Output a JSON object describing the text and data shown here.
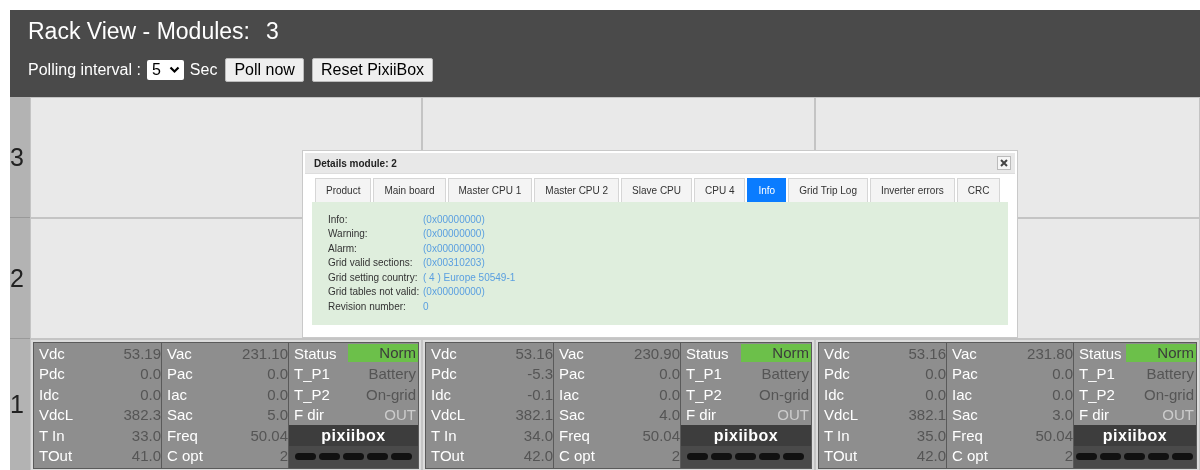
{
  "header": {
    "title": "Rack View - Modules:",
    "module_count": "3"
  },
  "controls": {
    "polling_label": "Polling interval :",
    "interval": "5",
    "unit": "Sec",
    "buttons": [
      "Poll now",
      "Reset PixiiBox"
    ]
  },
  "rack": {
    "rows": [
      {
        "number": "3",
        "modules": []
      },
      {
        "number": "2",
        "modules": []
      },
      {
        "number": "1",
        "modules": [
          {
            "left": [
              {
                "label": "Vdc",
                "value": "53.19"
              },
              {
                "label": "Pdc",
                "value": "0.0"
              },
              {
                "label": "Idc",
                "value": "0.0"
              },
              {
                "label": "VdcL",
                "value": "382.3"
              },
              {
                "label": "T In",
                "value": "33.0"
              },
              {
                "label": "TOut",
                "value": "41.0"
              }
            ],
            "middle": [
              {
                "label": "Vac",
                "value": "231.10"
              },
              {
                "label": "Pac",
                "value": "0.0"
              },
              {
                "label": "Iac",
                "value": "0.0"
              },
              {
                "label": "Sac",
                "value": "5.0"
              },
              {
                "label": "Freq",
                "value": "50.04"
              },
              {
                "label": "C opt",
                "value": "2"
              }
            ],
            "status": [
              {
                "label": "Status",
                "value": "Norm",
                "kind": "badge"
              },
              {
                "label": "T_P1",
                "value": "Battery",
                "kind": "plain"
              },
              {
                "label": "T_P2",
                "value": "On-grid",
                "kind": "plain"
              },
              {
                "label": "F dir",
                "value": "OUT",
                "kind": "dim"
              }
            ],
            "logo": "pixiibox"
          },
          {
            "left": [
              {
                "label": "Vdc",
                "value": "53.16"
              },
              {
                "label": "Pdc",
                "value": "-5.3"
              },
              {
                "label": "Idc",
                "value": "-0.1"
              },
              {
                "label": "VdcL",
                "value": "382.1"
              },
              {
                "label": "T In",
                "value": "34.0"
              },
              {
                "label": "TOut",
                "value": "42.0"
              }
            ],
            "middle": [
              {
                "label": "Vac",
                "value": "230.90"
              },
              {
                "label": "Pac",
                "value": "0.0"
              },
              {
                "label": "Iac",
                "value": "0.0"
              },
              {
                "label": "Sac",
                "value": "4.0"
              },
              {
                "label": "Freq",
                "value": "50.04"
              },
              {
                "label": "C opt",
                "value": "2"
              }
            ],
            "status": [
              {
                "label": "Status",
                "value": "Norm",
                "kind": "badge"
              },
              {
                "label": "T_P1",
                "value": "Battery",
                "kind": "plain"
              },
              {
                "label": "T_P2",
                "value": "On-grid",
                "kind": "plain"
              },
              {
                "label": "F dir",
                "value": "OUT",
                "kind": "dim"
              }
            ],
            "logo": "pixiibox"
          },
          {
            "left": [
              {
                "label": "Vdc",
                "value": "53.16"
              },
              {
                "label": "Pdc",
                "value": "0.0"
              },
              {
                "label": "Idc",
                "value": "0.0"
              },
              {
                "label": "VdcL",
                "value": "382.1"
              },
              {
                "label": "T In",
                "value": "35.0"
              },
              {
                "label": "TOut",
                "value": "42.0"
              }
            ],
            "middle": [
              {
                "label": "Vac",
                "value": "231.80"
              },
              {
                "label": "Pac",
                "value": "0.0"
              },
              {
                "label": "Iac",
                "value": "0.0"
              },
              {
                "label": "Sac",
                "value": "3.0"
              },
              {
                "label": "Freq",
                "value": "50.04"
              },
              {
                "label": "C opt",
                "value": "2"
              }
            ],
            "status": [
              {
                "label": "Status",
                "value": "Norm",
                "kind": "badge"
              },
              {
                "label": "T_P1",
                "value": "Battery",
                "kind": "plain"
              },
              {
                "label": "T_P2",
                "value": "On-grid",
                "kind": "plain"
              },
              {
                "label": "F dir",
                "value": "OUT",
                "kind": "dim"
              }
            ],
            "logo": "pixiibox"
          }
        ]
      }
    ]
  },
  "dialog": {
    "title": "Details module: 2",
    "tabs": [
      {
        "label": "Product",
        "selected": false
      },
      {
        "label": "Main board",
        "selected": false
      },
      {
        "label": "Master CPU 1",
        "selected": false
      },
      {
        "label": "Master CPU 2",
        "selected": false
      },
      {
        "label": "Slave CPU",
        "selected": false
      },
      {
        "label": "CPU 4",
        "selected": false
      },
      {
        "label": "Info",
        "selected": true
      },
      {
        "label": "Grid Trip Log",
        "selected": false
      },
      {
        "label": "Inverter errors",
        "selected": false
      },
      {
        "label": "CRC",
        "selected": false
      }
    ],
    "fields": [
      {
        "label": "Info:",
        "value": "(0x00000000)"
      },
      {
        "label": "Warning:",
        "value": "(0x00000000)"
      },
      {
        "label": "Alarm:",
        "value": "(0x00000000)"
      },
      {
        "label": "Grid valid sections:",
        "value": "(0x00310203)"
      },
      {
        "label": "Grid setting country:",
        "value": "( 4 ) Europe 50549-1"
      },
      {
        "label": "Grid tables not valid:",
        "value": "(0x00000000)"
      },
      {
        "label": "Revision number:",
        "value": "0"
      }
    ]
  }
}
